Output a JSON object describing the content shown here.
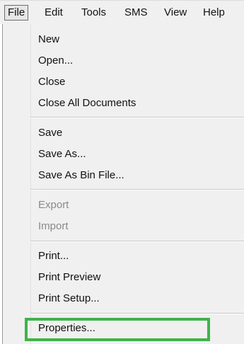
{
  "menubar": {
    "items": [
      {
        "label": "File"
      },
      {
        "label": "Edit"
      },
      {
        "label": "Tools"
      },
      {
        "label": "SMS"
      },
      {
        "label": "View"
      },
      {
        "label": "Help"
      }
    ],
    "active": "File"
  },
  "file_menu": {
    "groups": [
      [
        {
          "label": "New",
          "enabled": true
        },
        {
          "label": "Open...",
          "enabled": true
        },
        {
          "label": "Close",
          "enabled": true
        },
        {
          "label": "Close All Documents",
          "enabled": true
        }
      ],
      [
        {
          "label": "Save",
          "enabled": true
        },
        {
          "label": "Save As...",
          "enabled": true
        },
        {
          "label": "Save As Bin File...",
          "enabled": true
        }
      ],
      [
        {
          "label": "Export",
          "enabled": false
        },
        {
          "label": "Import",
          "enabled": false
        }
      ],
      [
        {
          "label": "Print...",
          "enabled": true
        },
        {
          "label": "Print Preview",
          "enabled": true
        },
        {
          "label": "Print Setup...",
          "enabled": true
        }
      ],
      [
        {
          "label": "Properties...",
          "enabled": true
        }
      ]
    ]
  },
  "colors": {
    "highlight": "#3fb34a",
    "disabled_text": "#8a8a8a",
    "menu_background": "#f0f0f0"
  }
}
